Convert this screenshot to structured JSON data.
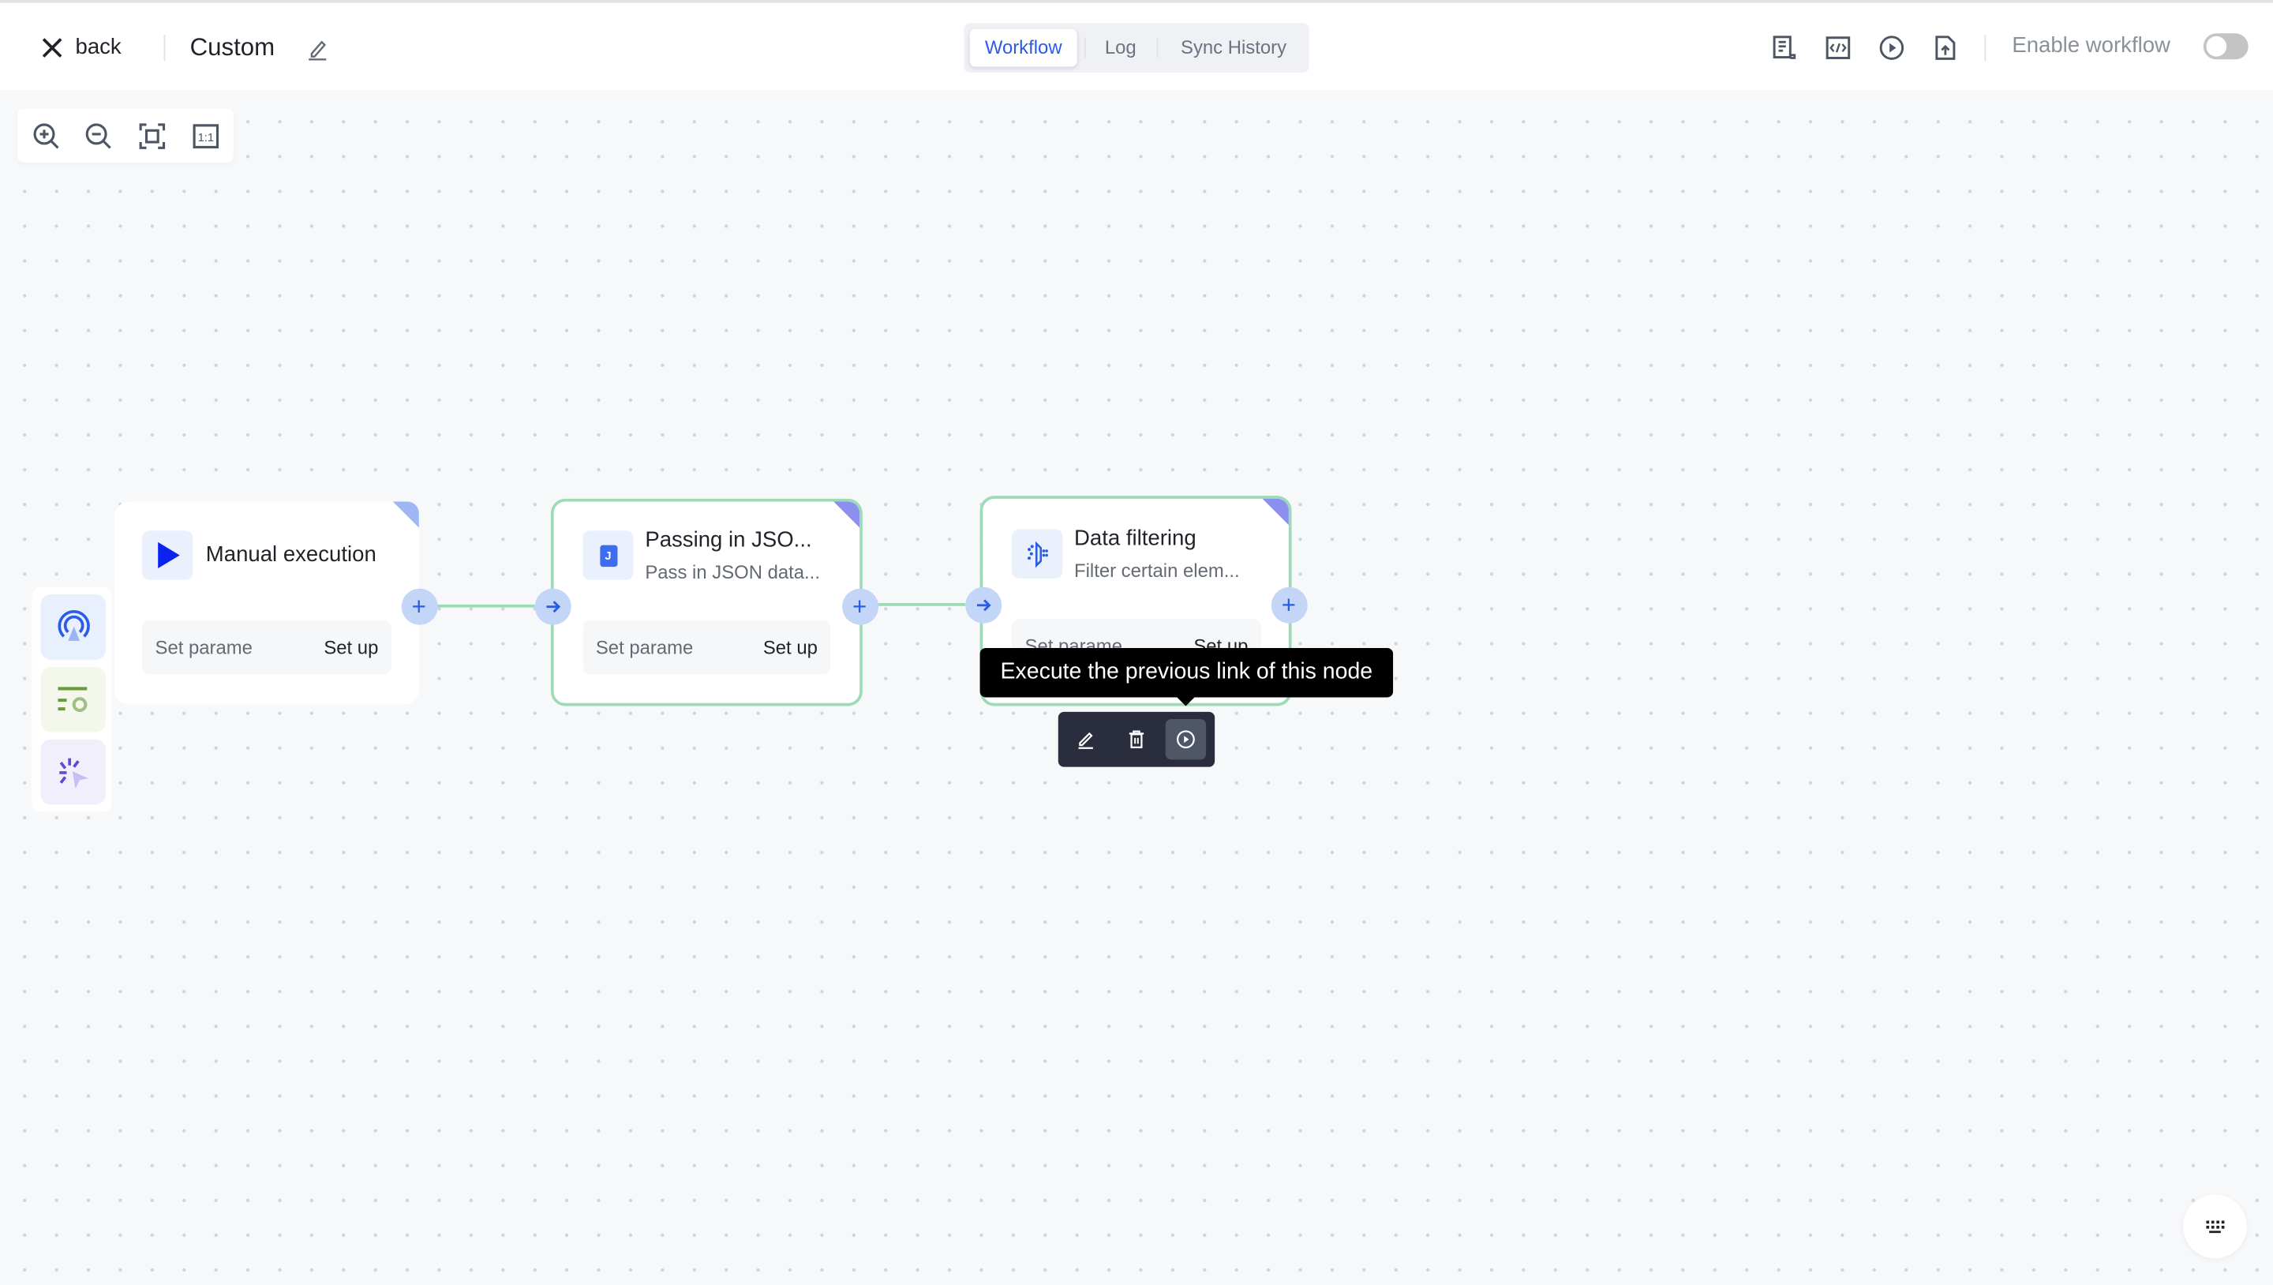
{
  "header": {
    "back_label": "back",
    "title": "Custom",
    "tabs": [
      {
        "label": "Workflow",
        "active": true
      },
      {
        "label": "Log",
        "active": false
      },
      {
        "label": "Sync History",
        "active": false
      }
    ],
    "right_icons": [
      "document-icon",
      "code-icon",
      "play-circle-icon",
      "upload-file-icon"
    ],
    "enable_label": "Enable workflow",
    "enabled": false
  },
  "toolbar": {
    "icons": [
      "zoom-in-icon",
      "zoom-out-icon",
      "fit-view-icon",
      "actual-size-icon"
    ],
    "actual_size_label": "1:1"
  },
  "palette": {
    "items": [
      "trigger-icon",
      "config-icon",
      "click-action-icon"
    ]
  },
  "nodes": [
    {
      "title": "Manual execution",
      "subtitle": "",
      "icon": "play-icon",
      "param_label": "Set parame",
      "setup_label": "Set up"
    },
    {
      "title": "Passing in JSO...",
      "subtitle": "Pass in JSON data...",
      "icon": "json-icon",
      "icon_letter": "J",
      "param_label": "Set parame",
      "setup_label": "Set up"
    },
    {
      "title": "Data filtering",
      "subtitle": "Filter certain elem...",
      "icon": "filter-icon",
      "param_label": "Set parame",
      "setup_label": "Set up"
    }
  ],
  "tooltip": "Execute the previous link of this node",
  "node_actions": [
    "edit-icon",
    "delete-icon",
    "run-icon"
  ],
  "colors": {
    "accent": "#2b5ce6",
    "edge": "#9ddbb6",
    "port": "#c3d6f7",
    "tooltip": "#000000",
    "action_bar": "#2a2d3e"
  }
}
